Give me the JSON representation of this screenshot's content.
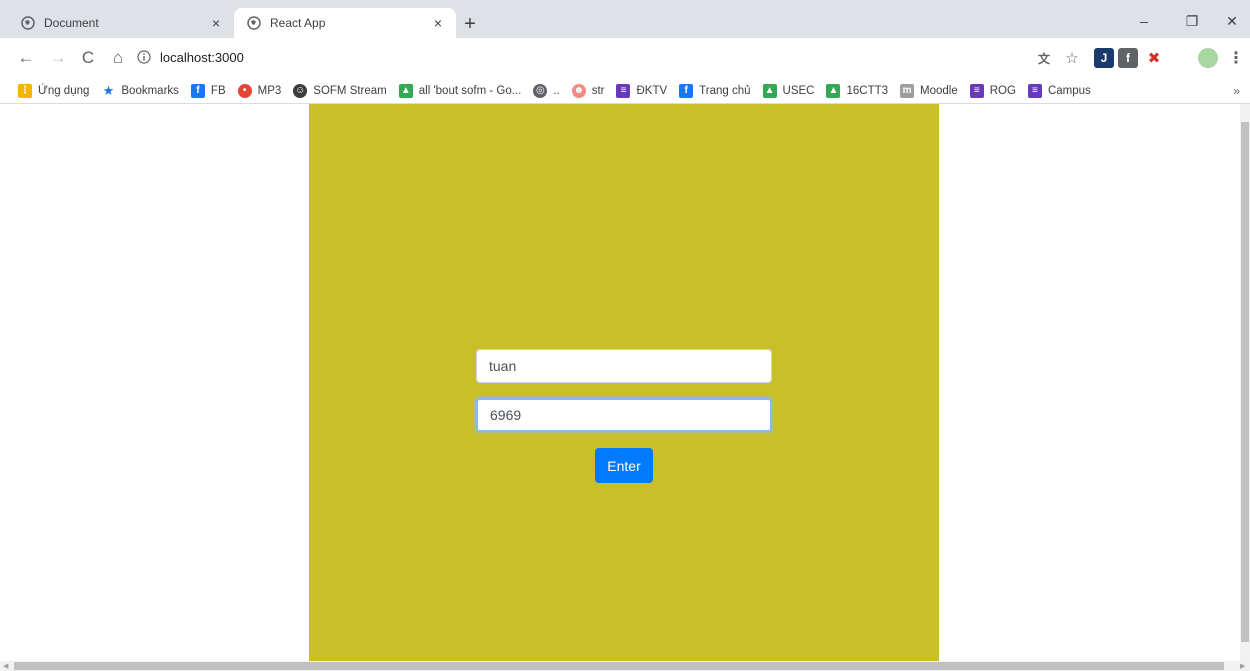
{
  "tabs": [
    {
      "title": "Document",
      "close": "×",
      "active": false
    },
    {
      "title": "React App",
      "close": "×",
      "active": true
    }
  ],
  "new_tab_symbol": "+",
  "window_controls": {
    "minimize": "–",
    "restore": "❐",
    "close": "✕"
  },
  "toolbar": {
    "back": "←",
    "forward": "→",
    "reload": "C",
    "home": "⌂",
    "address": "localhost:3000",
    "menu": "⋮",
    "star": "☆"
  },
  "extensions": [
    {
      "name": "translate-icon",
      "glyph": "文"
    },
    {
      "name": "j-extension-icon",
      "glyph": "J"
    },
    {
      "name": "facebook-extension-icon",
      "glyph": "f"
    },
    {
      "name": "x-extension-icon",
      "glyph": "✖"
    }
  ],
  "bookmarks": [
    {
      "label": "Ứng dụng",
      "icon": "apps-grid-icon",
      "color": "#f4b400"
    },
    {
      "label": "Bookmarks",
      "icon": "star-icon",
      "color": "#1a73e8"
    },
    {
      "label": "FB",
      "icon": "facebook-icon",
      "color": "#1877f2"
    },
    {
      "label": "MP3",
      "icon": "mp3-icon",
      "color": "#e94335"
    },
    {
      "label": "SOFM Stream",
      "icon": "sofm-icon",
      "color": "#3c3c3c"
    },
    {
      "label": "all 'bout sofm - Go...",
      "icon": "drive-icon",
      "color": "#34a853"
    },
    {
      "label": "..",
      "icon": "globe-icon",
      "color": "#5f6368"
    },
    {
      "label": "str",
      "icon": "avatar-icon",
      "color": "#f28b82"
    },
    {
      "label": "ĐKTV",
      "icon": "list-icon",
      "color": "#673ab7"
    },
    {
      "label": "Trang chủ",
      "icon": "facebook-icon",
      "color": "#1877f2"
    },
    {
      "label": "USEC",
      "icon": "drive-icon",
      "color": "#34a853"
    },
    {
      "label": "16CTT3",
      "icon": "drive-icon",
      "color": "#34a853"
    },
    {
      "label": "Moodle",
      "icon": "moodle-icon",
      "color": "#9e9e9e"
    },
    {
      "label": "ROG",
      "icon": "list-icon",
      "color": "#673ab7"
    },
    {
      "label": "Campus",
      "icon": "list-icon",
      "color": "#673ab7"
    }
  ],
  "bookmarks_overflow": "»",
  "form": {
    "username_value": "tuan",
    "password_value": "6969",
    "submit_label": "Enter"
  },
  "colors": {
    "panel_background": "#c9bf2b",
    "button_primary": "#007bff"
  }
}
